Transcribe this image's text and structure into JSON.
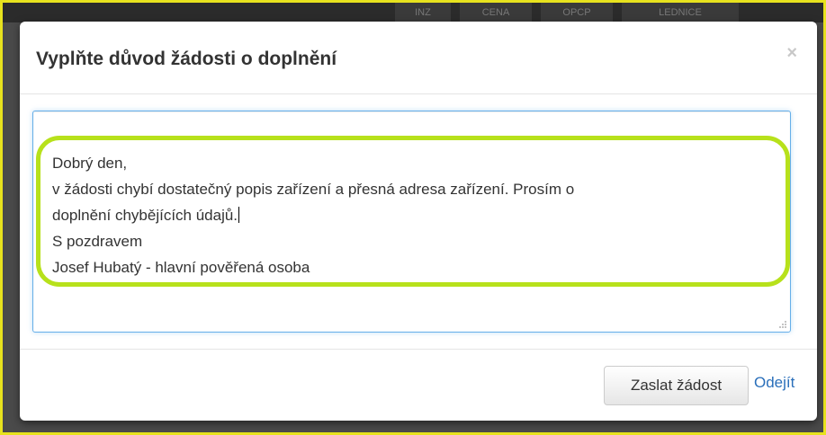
{
  "background": {
    "tabs": [
      "INZ",
      "CENA",
      "OPCP",
      "LEDNICE"
    ]
  },
  "modal": {
    "title": "Vyplňte důvod žádosti o doplnění",
    "close_label": "×",
    "textarea": {
      "lines": [
        "Dobrý den,",
        "v žádosti chybí dostatečný popis zařízení a přesná adresa zařízení. Prosím o",
        "doplnění chybějících údajů.",
        "S pozdravem",
        "Josef Hubatý - hlavní pověřená osoba"
      ]
    },
    "footer": {
      "submit_label": "Zaslat žádost",
      "leave_label": "Odejít"
    }
  },
  "colors": {
    "highlight": "#b7e11b",
    "focus_border": "#66afe9",
    "link": "#2a6fba",
    "page_border": "#e7e21e"
  }
}
